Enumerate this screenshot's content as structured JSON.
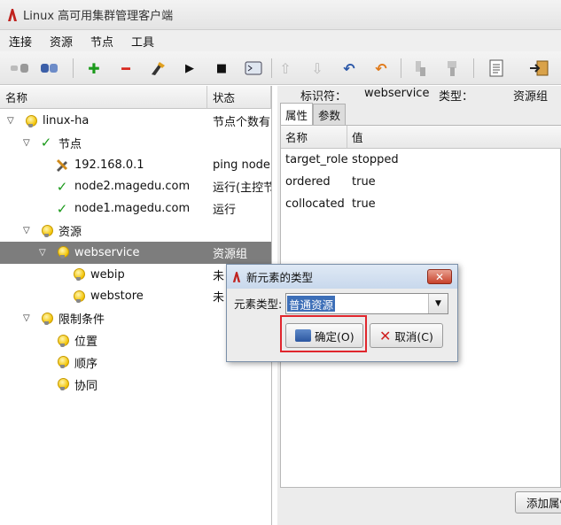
{
  "window": {
    "title": "Linux 高可用集群管理客户端"
  },
  "menu": [
    "连接",
    "资源",
    "节点",
    "工具"
  ],
  "tree": {
    "col_name": "名称",
    "col_status": "状态",
    "rows": [
      {
        "label": "linux-ha",
        "status": "节点个数有",
        "icon": "bulb-icon",
        "expander": "▽"
      },
      {
        "label": "节点",
        "status": "",
        "icon": "check-icon",
        "expander": "▽"
      },
      {
        "label": "192.168.0.1",
        "status": "ping node",
        "icon": "tools-icon",
        "expander": ""
      },
      {
        "label": "node2.magedu.com",
        "status": "运行(主控节",
        "icon": "check-icon",
        "expander": ""
      },
      {
        "label": "node1.magedu.com",
        "status": "运行",
        "icon": "check-icon",
        "expander": ""
      },
      {
        "label": "资源",
        "status": "",
        "icon": "bulb-icon",
        "expander": "▽"
      },
      {
        "label": "webservice",
        "status": "资源组",
        "icon": "bulb-icon",
        "expander": "▽",
        "selected": true
      },
      {
        "label": "webip",
        "status": "未",
        "icon": "bulb-icon",
        "expander": ""
      },
      {
        "label": "webstore",
        "status": "未",
        "icon": "bulb-icon",
        "expander": ""
      },
      {
        "label": "限制条件",
        "status": "",
        "icon": "bulb-icon",
        "expander": "▽"
      },
      {
        "label": "位置",
        "status": "",
        "icon": "bulb-icon",
        "expander": ""
      },
      {
        "label": "顺序",
        "status": "",
        "icon": "bulb-icon",
        "expander": ""
      },
      {
        "label": "协同",
        "status": "",
        "icon": "bulb-icon",
        "expander": ""
      }
    ]
  },
  "detail": {
    "id_label": "标识符：",
    "id_value": "webservice",
    "type_label": "类型：",
    "type_value": "资源组",
    "tabs": [
      "属性",
      "参数"
    ],
    "col_name": "名称",
    "col_value": "值",
    "props": [
      {
        "k": "target_role",
        "v": "stopped"
      },
      {
        "k": "ordered",
        "v": "true"
      },
      {
        "k": "collocated",
        "v": "true"
      }
    ],
    "add_button": "添加属性"
  },
  "dialog": {
    "title": "新元素的类型",
    "field_label": "元素类型:",
    "field_value": "普通资源",
    "ok": "确定(O)",
    "cancel": "取消(C)"
  },
  "colors": {
    "selection": "#7d7d7d",
    "highlight_frame": "#e0262d",
    "combo_select": "#3d6fb8"
  }
}
